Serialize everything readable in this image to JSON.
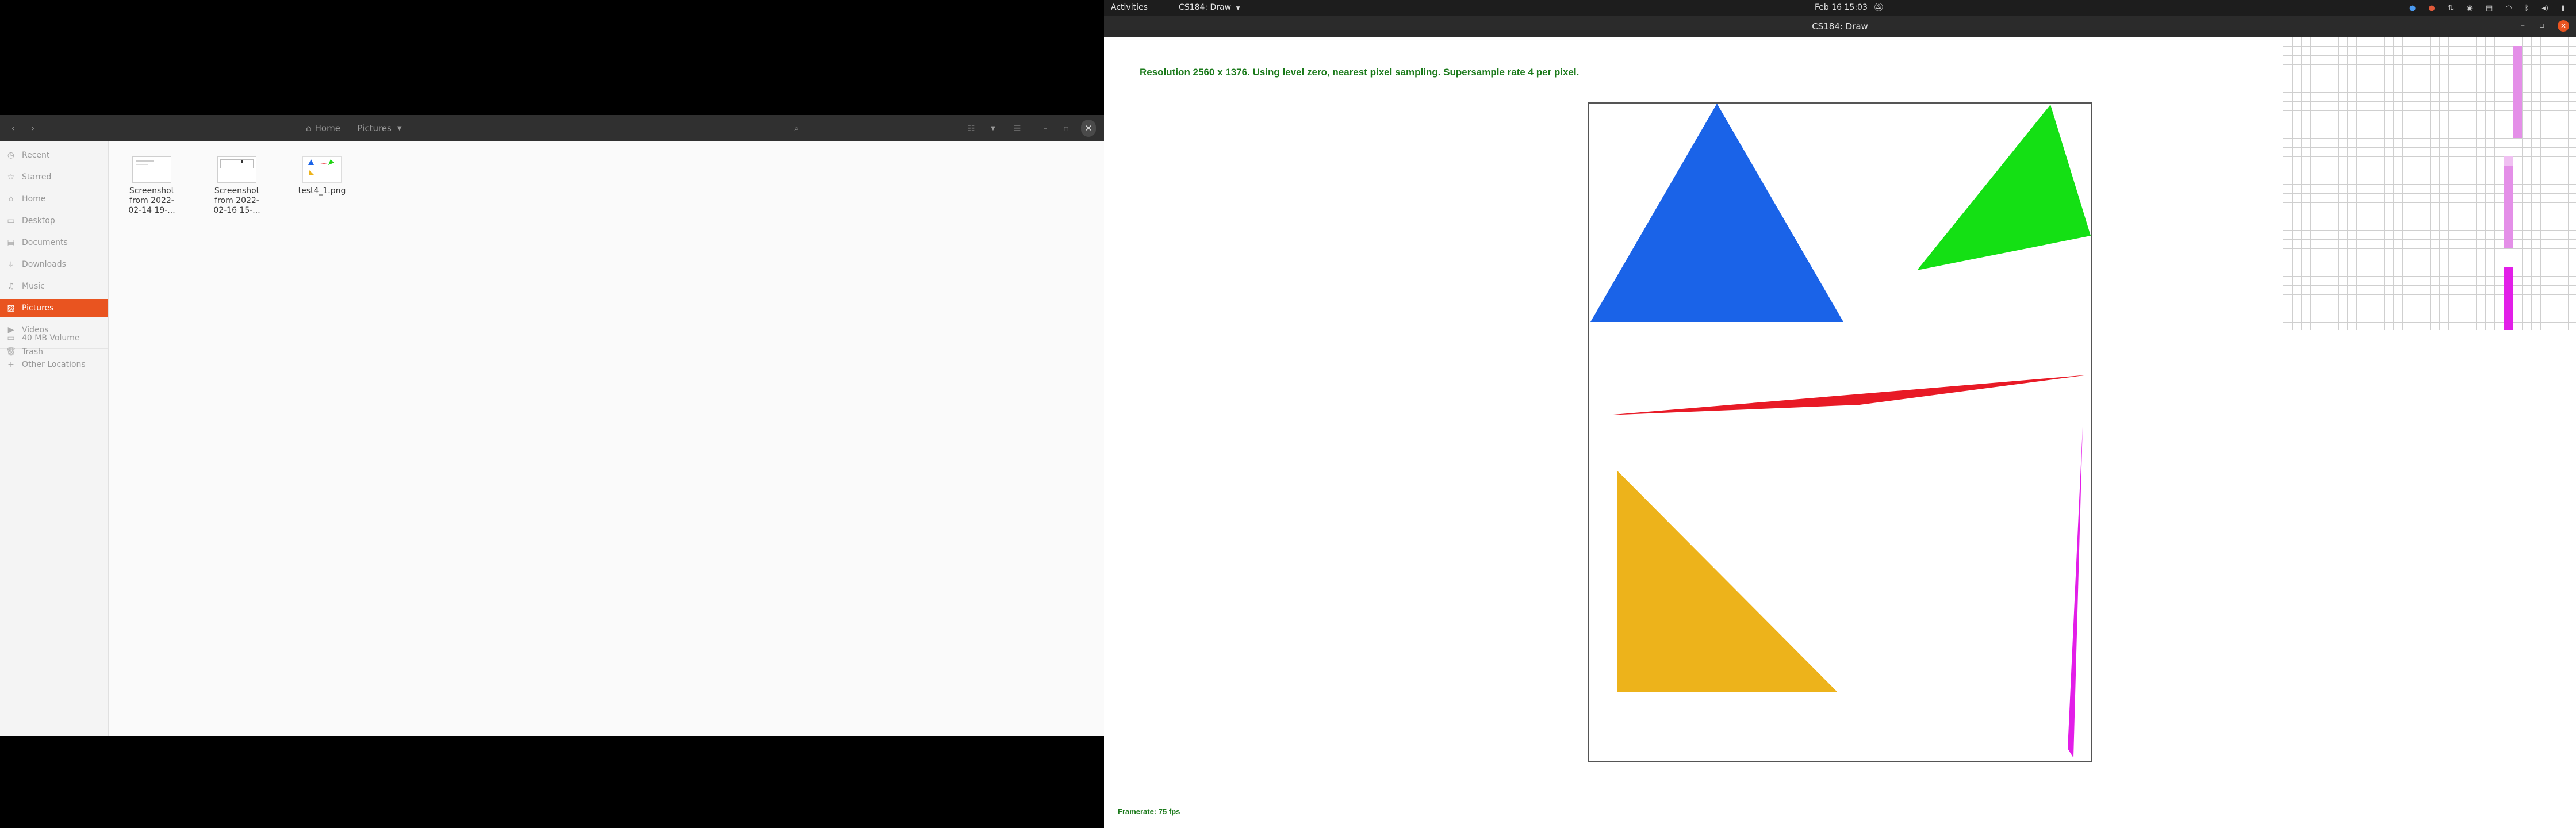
{
  "files": {
    "nav": {
      "back_icon": "chevron-left-icon",
      "forward_icon": "chevron-right-icon"
    },
    "path": {
      "home": "Home",
      "current": "Pictures"
    },
    "sidebar": [
      {
        "label": "Recent",
        "icon": "clock-icon",
        "active": false
      },
      {
        "label": "Starred",
        "icon": "star-icon",
        "active": false
      },
      {
        "label": "Home",
        "icon": "home-icon",
        "active": false
      },
      {
        "label": "Desktop",
        "icon": "desktop-icon",
        "active": false
      },
      {
        "label": "Documents",
        "icon": "document-icon",
        "active": false
      },
      {
        "label": "Downloads",
        "icon": "download-icon",
        "active": false
      },
      {
        "label": "Music",
        "icon": "music-icon",
        "active": false
      },
      {
        "label": "Pictures",
        "icon": "picture-icon",
        "active": true
      },
      {
        "label": "Videos",
        "icon": "video-icon",
        "active": false
      },
      {
        "label": "Trash",
        "icon": "trash-icon",
        "active": false
      },
      {
        "label": "40 MB Volume",
        "icon": "drive-icon",
        "active": false
      },
      {
        "label": "Other Locations",
        "icon": "plus-icon",
        "active": false
      }
    ],
    "items": [
      {
        "name_lines": [
          "Screenshot",
          "from 2022-",
          "02-14 19-..."
        ]
      },
      {
        "name_lines": [
          "Screenshot",
          "from 2022-",
          "02-16 15-..."
        ]
      },
      {
        "name_lines": [
          "test4_1.png"
        ]
      }
    ]
  },
  "topbar": {
    "activities": "Activities",
    "app_menu": "CS184: Draw",
    "clock": "Feb 16  15:03"
  },
  "window_title": "CS184: Draw",
  "draw": {
    "status": "Resolution 2560 x 1376. Using level zero, nearest pixel sampling. Supersample rate 4 per pixel.",
    "framerate": "Framerate: 75 fps"
  },
  "colors": {
    "accent": "#e95420",
    "blue_triangle": "#1a63e8",
    "green_triangle": "#14e014",
    "red_sliver": "#e81a26",
    "yellow_triangle": "#edb31b",
    "magenta_sliver": "#e21ee8",
    "status_text": "#1b7a1b"
  }
}
